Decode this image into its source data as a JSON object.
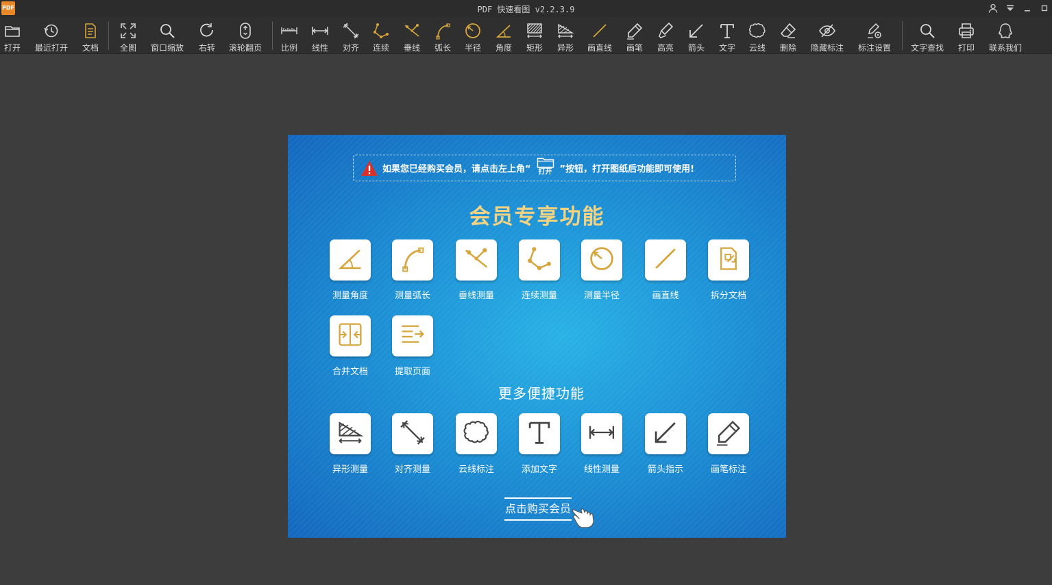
{
  "window": {
    "title": "PDF 快速看图 v2.2.3.9",
    "logo_text": "PDF"
  },
  "toolbar": {
    "items": [
      {
        "label": "打开",
        "icon": "folder-icon"
      },
      {
        "label": "最近打开",
        "icon": "history-icon"
      },
      {
        "label": "文档",
        "icon": "document-icon"
      },
      {
        "label": "全图",
        "icon": "fit-all-icon"
      },
      {
        "label": "窗口缩放",
        "icon": "zoom-icon"
      },
      {
        "label": "右转",
        "icon": "rotate-right-icon"
      },
      {
        "label": "滚轮翻页",
        "icon": "mouse-wheel-icon"
      },
      {
        "label": "比例",
        "icon": "scale-icon"
      },
      {
        "label": "线性",
        "icon": "linear-measure-icon"
      },
      {
        "label": "对齐",
        "icon": "align-measure-icon"
      },
      {
        "label": "连续",
        "icon": "continuous-measure-icon"
      },
      {
        "label": "垂线",
        "icon": "perpendicular-icon"
      },
      {
        "label": "弧长",
        "icon": "arc-length-icon"
      },
      {
        "label": "半径",
        "icon": "radius-icon"
      },
      {
        "label": "角度",
        "icon": "angle-icon"
      },
      {
        "label": "矩形",
        "icon": "rectangle-icon"
      },
      {
        "label": "异形",
        "icon": "irregular-shape-icon"
      },
      {
        "label": "画直线",
        "icon": "line-icon"
      },
      {
        "label": "画笔",
        "icon": "pen-icon"
      },
      {
        "label": "高亮",
        "icon": "highlighter-icon"
      },
      {
        "label": "箭头",
        "icon": "arrow-icon"
      },
      {
        "label": "文字",
        "icon": "text-icon"
      },
      {
        "label": "云线",
        "icon": "cloud-icon"
      },
      {
        "label": "删除",
        "icon": "eraser-icon"
      },
      {
        "label": "隐藏标注",
        "icon": "hide-eye-icon"
      },
      {
        "label": "标注设置",
        "icon": "markup-settings-icon"
      },
      {
        "label": "文字查找",
        "icon": "search-icon"
      },
      {
        "label": "打印",
        "icon": "printer-icon"
      },
      {
        "label": "联系我们",
        "icon": "qq-icon"
      }
    ]
  },
  "promo": {
    "notice_before": "如果您已经购买会员，请点击左上角“",
    "notice_icon_label": "打开",
    "notice_after": "”按钮，打开图纸后功能即可使用!",
    "member_title": "会员专享功能",
    "member_features": [
      {
        "label": "测量角度",
        "icon": "angle-icon"
      },
      {
        "label": "测量弧长",
        "icon": "arc-length-icon"
      },
      {
        "label": "垂线测量",
        "icon": "perpendicular-icon"
      },
      {
        "label": "连续测量",
        "icon": "continuous-measure-icon"
      },
      {
        "label": "测量半径",
        "icon": "radius-icon"
      },
      {
        "label": "画直线",
        "icon": "line-icon"
      },
      {
        "label": "拆分文档",
        "icon": "split-document-icon"
      },
      {
        "label": "合并文档",
        "icon": "merge-document-icon"
      },
      {
        "label": "提取页面",
        "icon": "extract-page-icon"
      }
    ],
    "more_title": "更多便捷功能",
    "more_features": [
      {
        "label": "异形测量",
        "icon": "irregular-shape-icon"
      },
      {
        "label": "对齐测量",
        "icon": "align-measure-icon"
      },
      {
        "label": "云线标注",
        "icon": "cloud-icon"
      },
      {
        "label": "添加文字",
        "icon": "text-icon"
      },
      {
        "label": "线性测量",
        "icon": "linear-measure-icon"
      },
      {
        "label": "箭头指示",
        "icon": "arrow-icon"
      },
      {
        "label": "画笔标注",
        "icon": "pen-icon"
      }
    ],
    "buy_label": "点击购买会员"
  },
  "colors": {
    "accent_gold": "#d6a53c",
    "toolbar_icon": "#d8d8d8",
    "panel_blue": "#1b8ad2",
    "heading_gold": "#f3d382"
  }
}
